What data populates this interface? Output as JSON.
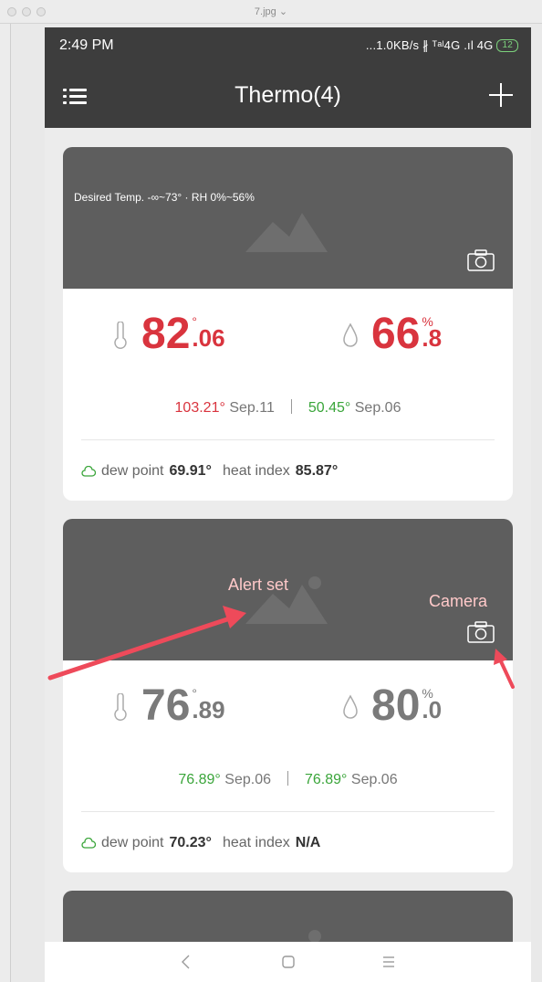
{
  "window": {
    "title": "7.jpg ⌄"
  },
  "status_bar": {
    "time": "2:49 PM",
    "network": "...1.0KB/s ∦ ᵀᵃˡ4G .ıl 4G",
    "battery": "12"
  },
  "nav": {
    "title": "Thermo(4)",
    "menu_icon": "menu-icon",
    "add_icon": "plus-icon"
  },
  "cards": [
    {
      "header_text": "Desired Temp. -∞~73° · RH 0%~56%",
      "temp": {
        "int": "82",
        "unit": "°",
        "dec": ".06",
        "color": "#d9343e"
      },
      "humidity": {
        "int": "66",
        "unit": "%",
        "dec": ".8",
        "color": "#d9343e"
      },
      "high": {
        "value": "103.21°",
        "date": "Sep.11",
        "color": "#d9343e"
      },
      "low": {
        "value": "50.45°",
        "date": "Sep.06",
        "color": "#3aa53a"
      },
      "dew_label": "dew point",
      "dew_value": "69.91°",
      "heat_label": "heat index",
      "heat_value": "85.87°"
    },
    {
      "header_text": "",
      "temp": {
        "int": "76",
        "unit": "°",
        "dec": ".89",
        "color": "#7a7a7a"
      },
      "humidity": {
        "int": "80",
        "unit": "%",
        "dec": ".0",
        "color": "#7a7a7a"
      },
      "high": {
        "value": "76.89°",
        "date": "Sep.06",
        "color": "#3aa53a"
      },
      "low": {
        "value": "76.89°",
        "date": "Sep.06",
        "color": "#3aa53a"
      },
      "dew_label": "dew point",
      "dew_value": "70.23°",
      "heat_label": "heat index",
      "heat_value": "N/A"
    }
  ],
  "annotations": {
    "alert": "Alert set",
    "camera": "Camera",
    "color": "#ee4a5a"
  },
  "bottom_nav": {
    "back_icon": "back-icon",
    "home_icon": "home-icon",
    "recents_icon": "recents-icon"
  }
}
